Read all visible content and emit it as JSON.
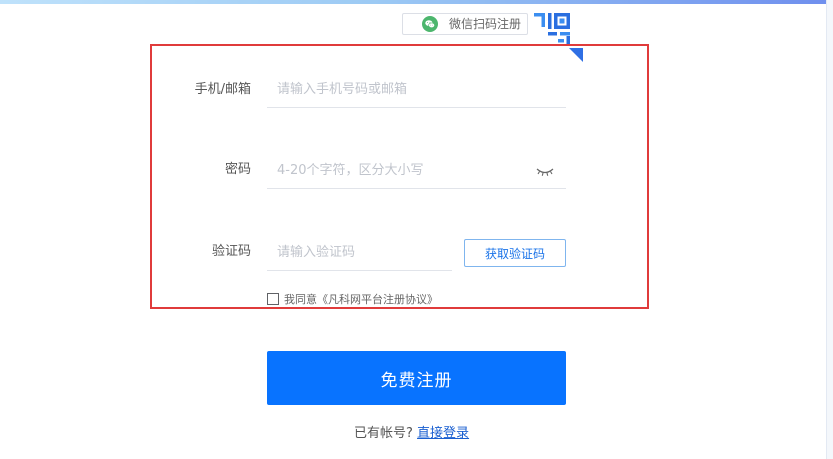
{
  "wechat": {
    "icon": "wechat-icon",
    "label": "微信扫码注册"
  },
  "qr_icon": "qr-code-icon",
  "form": {
    "account": {
      "label": "手机/邮箱",
      "placeholder": "请输入手机号码或邮箱"
    },
    "password": {
      "label": "密码",
      "placeholder": "4-20个字符，区分大小写",
      "toggle_icon": "eye-closed-icon"
    },
    "code": {
      "label": "验证码",
      "placeholder": "请输入验证码",
      "button_label": "获取验证码"
    },
    "agreement": {
      "prefix": "我同意",
      "link": "《凡科网平台注册协议》",
      "checked": false
    }
  },
  "submit_label": "免费注册",
  "login": {
    "prompt": "已有帐号?",
    "link": "直接登录"
  },
  "colors": {
    "primary": "#0873ff",
    "highlight_border": "#e03b3b",
    "link": "#1a5fd0"
  }
}
